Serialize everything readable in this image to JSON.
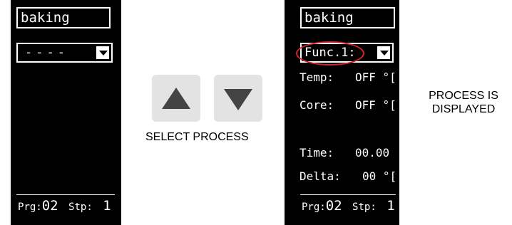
{
  "left_screen": {
    "title": "baking",
    "select_value": "----",
    "footer": {
      "prg_label": "Prg:",
      "prg_value": "02",
      "stp_label": "Stp:",
      "stp_value": "1"
    }
  },
  "keys": {
    "up_icon": "triangle-up-icon",
    "down_icon": "triangle-down-icon"
  },
  "select_caption": "SELECT PROCESS",
  "right_screen": {
    "title": "baking",
    "select_value": "Func.1:",
    "highlight_color": "#d9232a",
    "params": [
      {
        "label": "Temp:",
        "value": "OFF °["
      },
      {
        "label": "Core:",
        "value": "OFF °["
      },
      {
        "label": "Time:",
        "value": "00.00"
      },
      {
        "label": "Delta:",
        "value": "00 °["
      }
    ],
    "footer": {
      "prg_label": "Prg:",
      "prg_value": "02",
      "stp_label": "Stp:",
      "stp_value": "1"
    }
  },
  "process_caption": {
    "line1": "PROCESS IS",
    "line2": "DISPLAYED"
  }
}
